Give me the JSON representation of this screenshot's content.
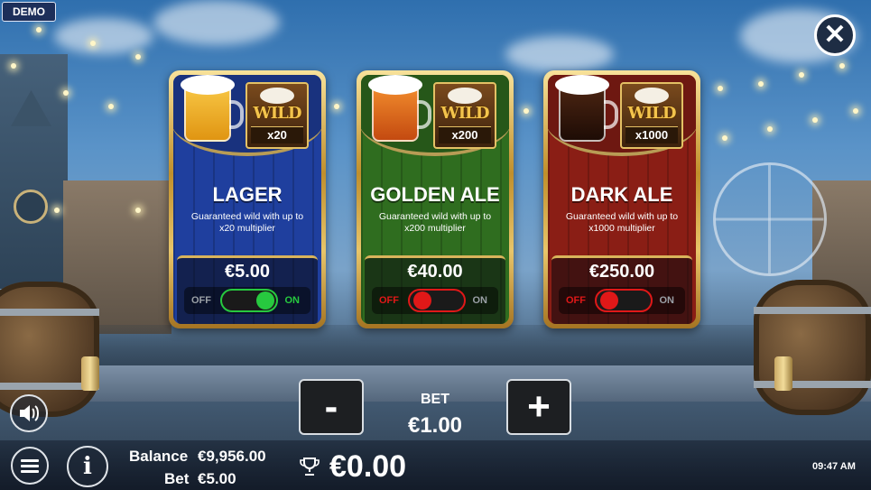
{
  "demo_badge": "DEMO",
  "close_icon": "close-icon",
  "cards": [
    {
      "title": "LAGER",
      "description": "Guaranteed wild with up to x20 multiplier",
      "wild_word": "WILD",
      "multiplier": "x20",
      "price": "€5.00",
      "toggle_off": "OFF",
      "toggle_on": "ON",
      "enabled": true,
      "color": "#1f3f9e"
    },
    {
      "title": "GOLDEN ALE",
      "description": "Guaranteed wild with up to x200 multiplier",
      "wild_word": "WILD",
      "multiplier": "x200",
      "price": "€40.00",
      "toggle_off": "OFF",
      "toggle_on": "ON",
      "enabled": false,
      "color": "#2f6d1f"
    },
    {
      "title": "DARK ALE",
      "description": "Guaranteed wild with up to x1000 multiplier",
      "wild_word": "WILD",
      "multiplier": "x1000",
      "price": "€250.00",
      "toggle_off": "OFF",
      "toggle_on": "ON",
      "enabled": false,
      "color": "#8a1e15"
    }
  ],
  "bet": {
    "label": "BET",
    "value": "€1.00",
    "decrease_label": "-",
    "increase_label": "+"
  },
  "footer": {
    "balance_label": "Balance",
    "balance_value": "€9,956.00",
    "bet_label": "Bet",
    "bet_value": "€5.00",
    "win_value": "€0.00",
    "time": "09:47 AM",
    "info_label": "i"
  },
  "colors": {
    "toggle_on": "#27c93f",
    "toggle_off": "#e01818"
  }
}
